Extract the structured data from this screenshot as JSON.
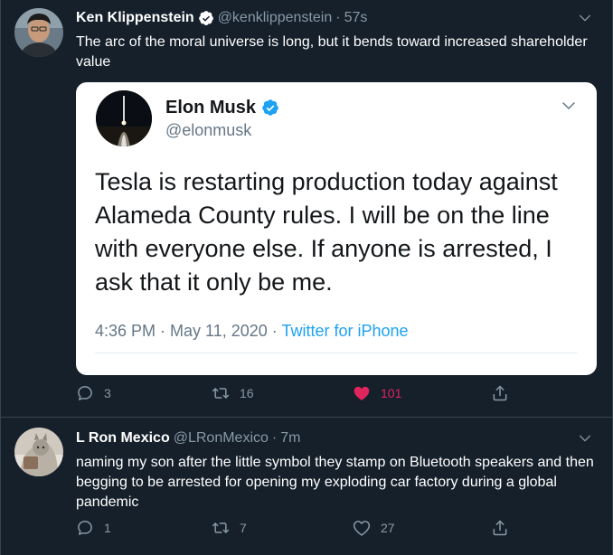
{
  "tweets": [
    {
      "display_name": "Ken Klippenstein",
      "handle": "@kenklippenstein",
      "separator": "·",
      "time": "57s",
      "text": "The arc of the moral universe is long, but it bends toward increased shareholder value",
      "quote": {
        "display_name": "Elon Musk",
        "handle": "@elonmusk",
        "text": "Tesla is restarting production today against Alameda County rules. I will be on the line with everyone else. If anyone is arrested, I ask that it only be me.",
        "timestamp": "4:36 PM · May 11, 2020",
        "separator": "·",
        "source": "Twitter for iPhone"
      },
      "reply_count": "3",
      "retweet_count": "16",
      "like_count": "101",
      "liked": true
    },
    {
      "display_name": "L Ron Mexico",
      "handle": "@LRonMexico",
      "separator": "·",
      "time": "7m",
      "text": "naming my son after the little symbol they stamp on Bluetooth speakers and then begging to be arrested for opening my exploding car factory during a global pandemic",
      "reply_count": "1",
      "retweet_count": "7",
      "like_count": "27",
      "liked": false
    }
  ],
  "icons": {
    "verified": "verified-badge-icon",
    "caret": "chevron-down-icon",
    "reply": "reply-icon",
    "retweet": "retweet-icon",
    "like": "heart-icon",
    "share": "share-icon"
  },
  "colors": {
    "background": "#15202b",
    "text_primary": "#ffffff",
    "text_secondary": "#8899a6",
    "accent": "#1da1f2",
    "like": "#e0245e",
    "card_background": "#ffffff"
  }
}
